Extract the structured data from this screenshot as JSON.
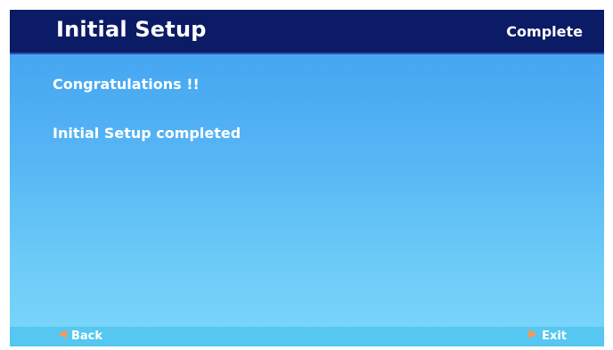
{
  "header": {
    "title": "Initial Setup",
    "status": "Complete"
  },
  "messages": {
    "line1": "Congratulations !!",
    "line2": "Initial Setup completed"
  },
  "footer": {
    "back_label": "Back",
    "exit_label": "Exit",
    "back_icon": "arrow-left-icon",
    "exit_icon": "arrow-right-icon",
    "icon_color": "#f29a5a"
  },
  "colors": {
    "header_bg": "#0b1b66",
    "body_bg_top": "#3f9ff0",
    "body_bg_bottom": "#7ad6fa",
    "footer_bg": "#55c7f1",
    "text": "#ffffff"
  }
}
